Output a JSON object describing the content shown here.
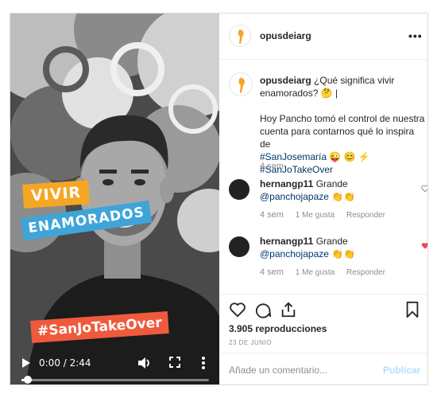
{
  "post": {
    "username": "opusdeiarg",
    "more_label": "•••",
    "caption": {
      "username": "opusdeiarg",
      "line1": "¿Qué significa vivir enamorados? 🤔 |",
      "line2": "Hoy Pancho tomó el control de nuestra cuenta para contarnos qué lo inspira de",
      "hashtag1": "#SanJosemaría",
      "emoji": " 😜 😊 ⚡",
      "hashtag2": "#SanJoTakeOver",
      "age": "4 sem"
    },
    "comments": [
      {
        "username": "hernangp11",
        "text": "Grande",
        "mention": "@panchojapaze",
        "emoji": " 👏👏",
        "age": "4 sem",
        "likes": "1 Me gusta",
        "reply": "Responder",
        "liked": false
      },
      {
        "username": "hernangp11",
        "text": "Grande",
        "mention": "@panchojapaze",
        "emoji": " 👏👏",
        "age": "4 sem",
        "likes": "1 Me gusta",
        "reply": "Responder",
        "liked": true
      }
    ],
    "views": "3.905 reproducciones",
    "date": "23 DE JUNIO",
    "add_comment": {
      "placeholder": "Añade un comentario...",
      "value": "",
      "submit": "Publicar"
    },
    "icons": [
      "heart-icon",
      "comment-icon",
      "share-icon",
      "bookmark-icon",
      "play-icon",
      "volume-icon",
      "fullscreen-icon",
      "more-vertical-icon"
    ],
    "colors": {
      "link": "#00376b",
      "muted": "#8e8e8e",
      "liked": "#ed4956",
      "publish_disabled": "#b2dffc",
      "logo": "#f5a623"
    }
  },
  "video": {
    "stickers": {
      "vivir": "VIVIR",
      "enamorados": "ENAMORADOS",
      "hashtag": "#SanJoTakeOver"
    },
    "time": "0:00 / 2:44",
    "progress": 0.02,
    "sticker_colors": {
      "vivir": "#f5a623",
      "enamorados": "#3fa5d8",
      "hashtag": "#ef5a3c"
    }
  }
}
